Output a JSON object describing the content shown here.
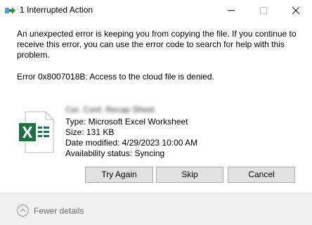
{
  "window": {
    "title": "1 Interrupted Action"
  },
  "message": {
    "body": "An unexpected error is keeping you from copying the file. If you continue to receive this error, you can use the error code to search for help with this problem.",
    "error": "Error 0x8007018B: Access to the cloud file is denied."
  },
  "file": {
    "name": "Cer. Conf. Recap Sheet",
    "type": "Type: Microsoft Excel Worksheet",
    "size": "Size: 131 KB",
    "modified": "Date modified: 4/29/2023 10:00 AM",
    "availability": "Availability status: Syncing"
  },
  "buttons": {
    "try_again": "Try Again",
    "skip": "Skip",
    "cancel": "Cancel"
  },
  "footer": {
    "toggle_label": "Fewer details"
  },
  "colors": {
    "excel_green": "#1e7145",
    "button_bg": "#e1e1e1",
    "footer_bg": "#f0f0f0"
  }
}
